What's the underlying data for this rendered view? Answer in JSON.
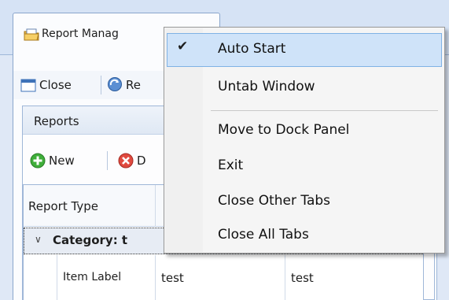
{
  "tab": {
    "label": "Report Manag",
    "close": "✕"
  },
  "toolbar": {
    "close": "Close",
    "second": "Re"
  },
  "group": {
    "title": "Reports"
  },
  "toolbar2": {
    "new": "New",
    "delete": "D"
  },
  "grid": {
    "columns": [
      "Report Type"
    ],
    "category": "Category: t",
    "row": {
      "label": "Item Label",
      "a": "test",
      "b": "test"
    }
  },
  "menu": {
    "items": [
      {
        "label": "Auto Start",
        "checked": true
      },
      {
        "label": "Untab Window"
      },
      {
        "label": "Move to Dock Panel"
      },
      {
        "label": "Exit"
      },
      {
        "label": "Close Other Tabs"
      },
      {
        "label": "Close All Tabs"
      }
    ],
    "check_glyph": "✔"
  },
  "colors": {
    "accent": "#cfe3f9",
    "accent_border": "#7fb2e5",
    "frame": "#dfe8f6"
  }
}
